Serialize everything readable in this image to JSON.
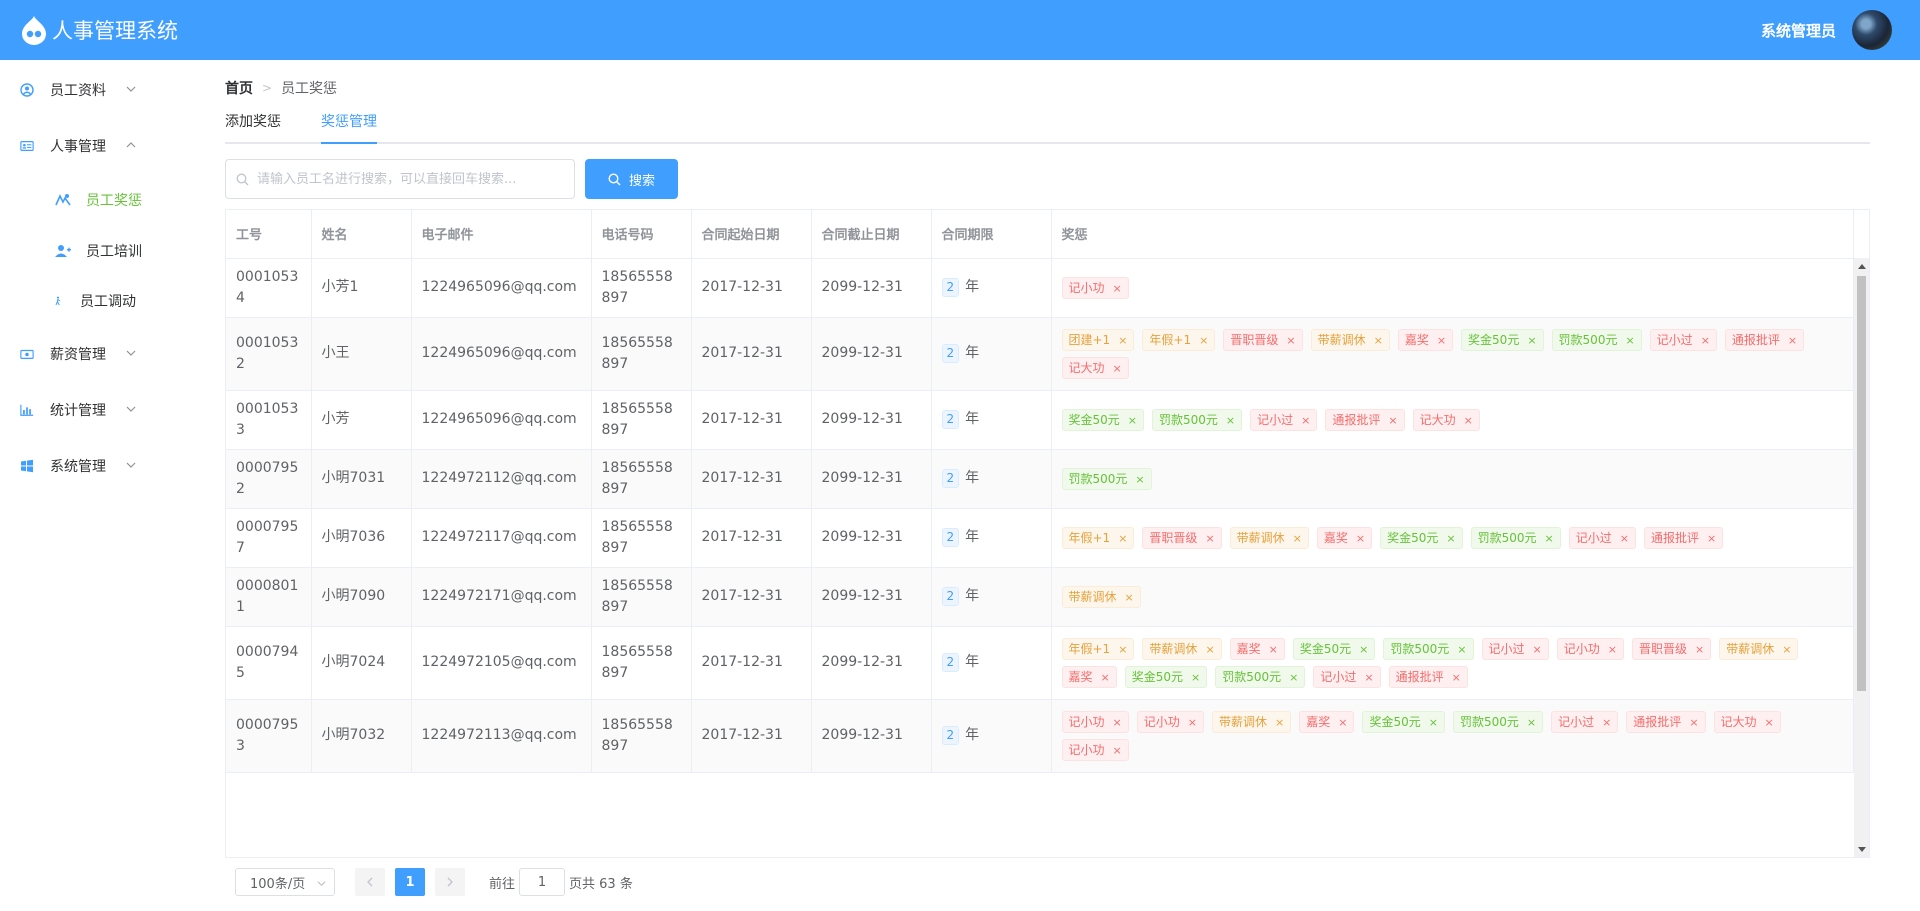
{
  "app": {
    "title": "人事管理系统",
    "user_name": "系统管理员"
  },
  "sidebar": {
    "items": [
      {
        "label": "员工资料",
        "icon": "user-circle-icon",
        "expanded": false
      },
      {
        "label": "人事管理",
        "icon": "id-card-icon",
        "expanded": true,
        "children": [
          {
            "label": "员工奖惩",
            "icon": "reward-icon",
            "active": true
          },
          {
            "label": "员工培训",
            "icon": "user-add-icon",
            "active": false
          },
          {
            "label": "员工调动",
            "icon": "walk-icon",
            "active": false
          }
        ]
      },
      {
        "label": "薪资管理",
        "icon": "money-icon",
        "expanded": false
      },
      {
        "label": "统计管理",
        "icon": "chart-icon",
        "expanded": false
      },
      {
        "label": "系统管理",
        "icon": "windows-icon",
        "expanded": false
      }
    ]
  },
  "breadcrumb": {
    "home": "首页",
    "current": "员工奖惩"
  },
  "tabs": [
    {
      "label": "添加奖惩",
      "active": false
    },
    {
      "label": "奖惩管理",
      "active": true
    }
  ],
  "search": {
    "placeholder": "请输入员工名进行搜索，可以直接回车搜索...",
    "button_label": "搜索"
  },
  "table": {
    "columns": [
      "工号",
      "姓名",
      "电子邮件",
      "电话号码",
      "合同起始日期",
      "合同截止日期",
      "合同期限",
      "奖惩"
    ],
    "period_unit": "年",
    "rows": [
      {
        "id": "00010534",
        "name": "小芳1",
        "email": "1224965096@qq.com",
        "phone": "18565558897",
        "start": "2017-12-31",
        "end": "2099-12-31",
        "period": "2",
        "tags": [
          {
            "label": "记小功",
            "type": "danger"
          }
        ]
      },
      {
        "id": "00010532",
        "name": "小王",
        "email": "1224965096@qq.com",
        "phone": "18565558897",
        "start": "2017-12-31",
        "end": "2099-12-31",
        "period": "2",
        "tags": [
          {
            "label": "团建+1",
            "type": "warning"
          },
          {
            "label": "年假+1",
            "type": "warning"
          },
          {
            "label": "晋职晋级",
            "type": "danger"
          },
          {
            "label": "带薪调休",
            "type": "warning"
          },
          {
            "label": "嘉奖",
            "type": "danger"
          },
          {
            "label": "奖金50元",
            "type": "success"
          },
          {
            "label": "罚款500元",
            "type": "success"
          },
          {
            "label": "记小过",
            "type": "danger"
          },
          {
            "label": "通报批评",
            "type": "danger"
          },
          {
            "label": "记大功",
            "type": "danger"
          }
        ]
      },
      {
        "id": "00010533",
        "name": "小芳",
        "email": "1224965096@qq.com",
        "phone": "18565558897",
        "start": "2017-12-31",
        "end": "2099-12-31",
        "period": "2",
        "tags": [
          {
            "label": "奖金50元",
            "type": "success"
          },
          {
            "label": "罚款500元",
            "type": "success"
          },
          {
            "label": "记小过",
            "type": "danger"
          },
          {
            "label": "通报批评",
            "type": "danger"
          },
          {
            "label": "记大功",
            "type": "danger"
          }
        ]
      },
      {
        "id": "00007952",
        "name": "小明7031",
        "email": "1224972112@qq.com",
        "phone": "18565558897",
        "start": "2017-12-31",
        "end": "2099-12-31",
        "period": "2",
        "tags": [
          {
            "label": "罚款500元",
            "type": "success"
          }
        ]
      },
      {
        "id": "00007957",
        "name": "小明7036",
        "email": "1224972117@qq.com",
        "phone": "18565558897",
        "start": "2017-12-31",
        "end": "2099-12-31",
        "period": "2",
        "tags": [
          {
            "label": "年假+1",
            "type": "warning"
          },
          {
            "label": "晋职晋级",
            "type": "danger"
          },
          {
            "label": "带薪调休",
            "type": "warning"
          },
          {
            "label": "嘉奖",
            "type": "danger"
          },
          {
            "label": "奖金50元",
            "type": "success"
          },
          {
            "label": "罚款500元",
            "type": "success"
          },
          {
            "label": "记小过",
            "type": "danger"
          },
          {
            "label": "通报批评",
            "type": "danger"
          }
        ]
      },
      {
        "id": "00008011",
        "name": "小明7090",
        "email": "1224972171@qq.com",
        "phone": "18565558897",
        "start": "2017-12-31",
        "end": "2099-12-31",
        "period": "2",
        "tags": [
          {
            "label": "带薪调休",
            "type": "warning"
          }
        ]
      },
      {
        "id": "00007945",
        "name": "小明7024",
        "email": "1224972105@qq.com",
        "phone": "18565558897",
        "start": "2017-12-31",
        "end": "2099-12-31",
        "period": "2",
        "tags": [
          {
            "label": "年假+1",
            "type": "warning"
          },
          {
            "label": "带薪调休",
            "type": "warning"
          },
          {
            "label": "嘉奖",
            "type": "danger"
          },
          {
            "label": "奖金50元",
            "type": "success"
          },
          {
            "label": "罚款500元",
            "type": "success"
          },
          {
            "label": "记小过",
            "type": "danger"
          },
          {
            "label": "记小功",
            "type": "danger"
          },
          {
            "label": "晋职晋级",
            "type": "danger"
          },
          {
            "label": "带薪调休",
            "type": "warning"
          },
          {
            "label": "嘉奖",
            "type": "danger"
          },
          {
            "label": "奖金50元",
            "type": "success"
          },
          {
            "label": "罚款500元",
            "type": "success"
          },
          {
            "label": "记小过",
            "type": "danger"
          },
          {
            "label": "通报批评",
            "type": "danger"
          }
        ]
      },
      {
        "id": "00007953",
        "name": "小明7032",
        "email": "1224972113@qq.com",
        "phone": "18565558897",
        "start": "2017-12-31",
        "end": "2099-12-31",
        "period": "2",
        "tags": [
          {
            "label": "记小功",
            "type": "danger"
          },
          {
            "label": "记小功",
            "type": "danger"
          },
          {
            "label": "带薪调休",
            "type": "warning"
          },
          {
            "label": "嘉奖",
            "type": "danger"
          },
          {
            "label": "奖金50元",
            "type": "success"
          },
          {
            "label": "罚款500元",
            "type": "success"
          },
          {
            "label": "记小过",
            "type": "danger"
          },
          {
            "label": "通报批评",
            "type": "danger"
          },
          {
            "label": "记大功",
            "type": "danger"
          },
          {
            "label": "记小功",
            "type": "danger"
          }
        ]
      }
    ]
  },
  "pagination": {
    "page_size_label": "100条/页",
    "current_page": "1",
    "goto_label": "前往",
    "goto_value": "1",
    "total_label": "页共 63 条"
  },
  "colors": {
    "primary": "#409EFF",
    "success": "#67C23A",
    "warning": "#E6A23C",
    "danger": "#F56C6C"
  }
}
